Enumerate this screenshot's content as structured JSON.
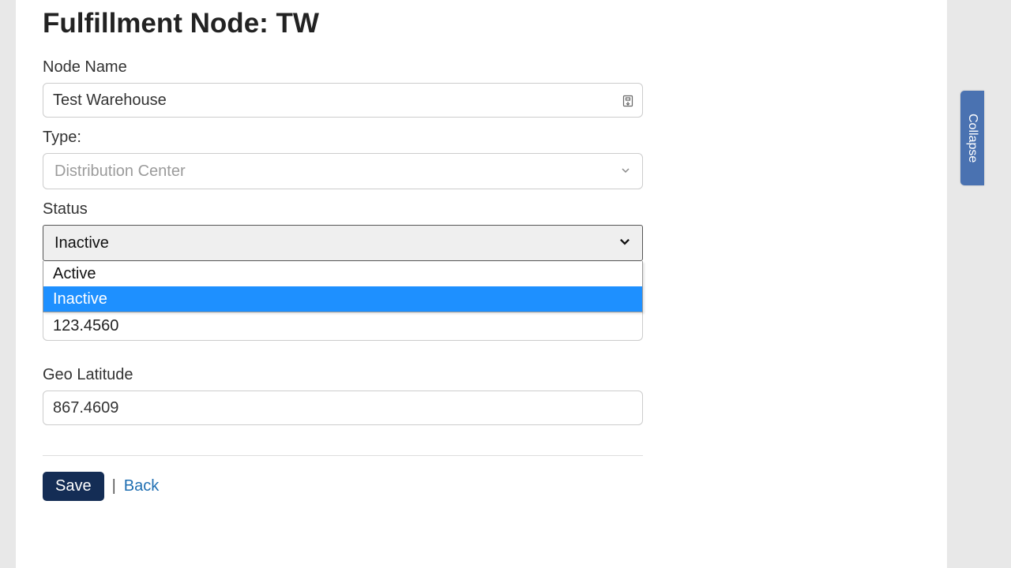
{
  "page": {
    "title": "Fulfillment Node: TW"
  },
  "nodeName": {
    "label": "Node Name",
    "value": "Test Warehouse"
  },
  "type": {
    "label": "Type:",
    "value": "Distribution Center"
  },
  "status": {
    "label": "Status",
    "value": "Inactive",
    "options": [
      "Active",
      "Inactive"
    ],
    "option0": "Active",
    "option1": "Inactive"
  },
  "overlappedField": {
    "value": "123.4560"
  },
  "geoLatitude": {
    "label": "Geo Latitude",
    "value": "867.4609"
  },
  "actions": {
    "save": "Save",
    "separator": "|",
    "back": "Back"
  },
  "sidebar": {
    "collapse": "Collapse"
  }
}
